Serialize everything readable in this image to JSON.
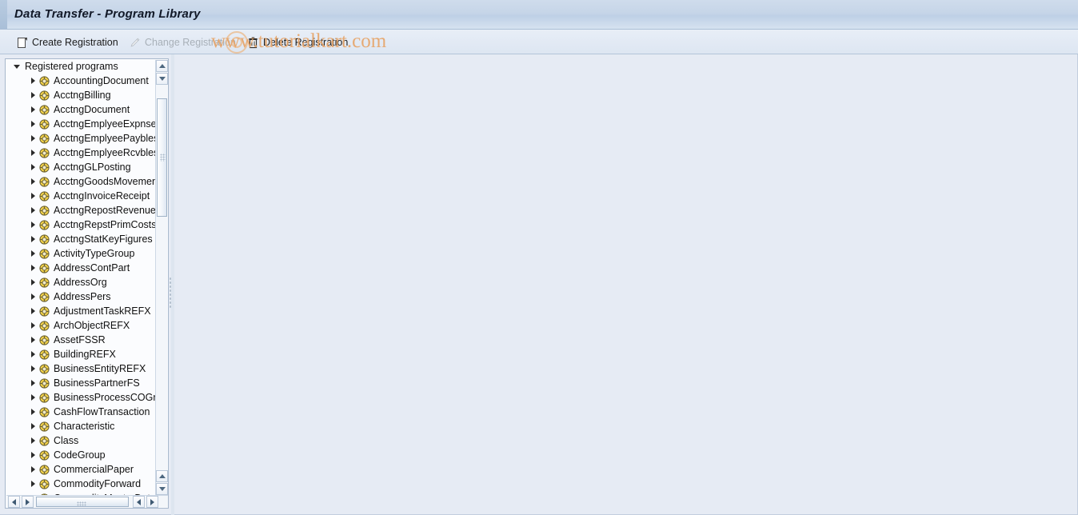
{
  "window": {
    "title": "Data Transfer - Program Library"
  },
  "toolbar": {
    "buttons": [
      {
        "label": "Create Registration",
        "icon": "document-icon",
        "enabled": true
      },
      {
        "label": "Change Registration",
        "icon": "pencil-icon",
        "enabled": false
      },
      {
        "label": "Delete Registration",
        "icon": "trash-icon",
        "enabled": true
      }
    ]
  },
  "watermark": {
    "text": "www.tutorialkart.com",
    "color": "#e7a56a"
  },
  "tree": {
    "root_label": "Registered programs",
    "node_icon": "bapi-object-icon",
    "items": [
      "AccountingDocument",
      "AcctngBilling",
      "AcctngDocument",
      "AcctngEmplyeeExpnses",
      "AcctngEmplyeePaybles",
      "AcctngEmplyeeRcvbles",
      "AcctngGLPosting",
      "AcctngGoodsMovement",
      "AcctngInvoiceReceipt",
      "AcctngRepostRevenue",
      "AcctngRepstPrimCosts",
      "AcctngStatKeyFigures",
      "ActivityTypeGroup",
      "AddressContPart",
      "AddressOrg",
      "AddressPers",
      "AdjustmentTaskREFX",
      "ArchObjectREFX",
      "AssetFSSR",
      "BuildingREFX",
      "BusinessEntityREFX",
      "BusinessPartnerFS",
      "BusinessProcessCOGrp",
      "CashFlowTransaction",
      "Characteristic",
      "Class",
      "CodeGroup",
      "CommercialPaper",
      "CommodityForward",
      "CommodityMasterData"
    ]
  },
  "scrollbars": {
    "vertical_up": "scroll-up",
    "vertical_down": "scroll-down",
    "horizontal_left": "scroll-left",
    "horizontal_right": "scroll-right"
  },
  "colors": {
    "titlebar": "#c6d5e8",
    "toolbar": "#e1e9f4",
    "content_background": "#e6ebf4",
    "tree_background": "#fbfcfe"
  }
}
